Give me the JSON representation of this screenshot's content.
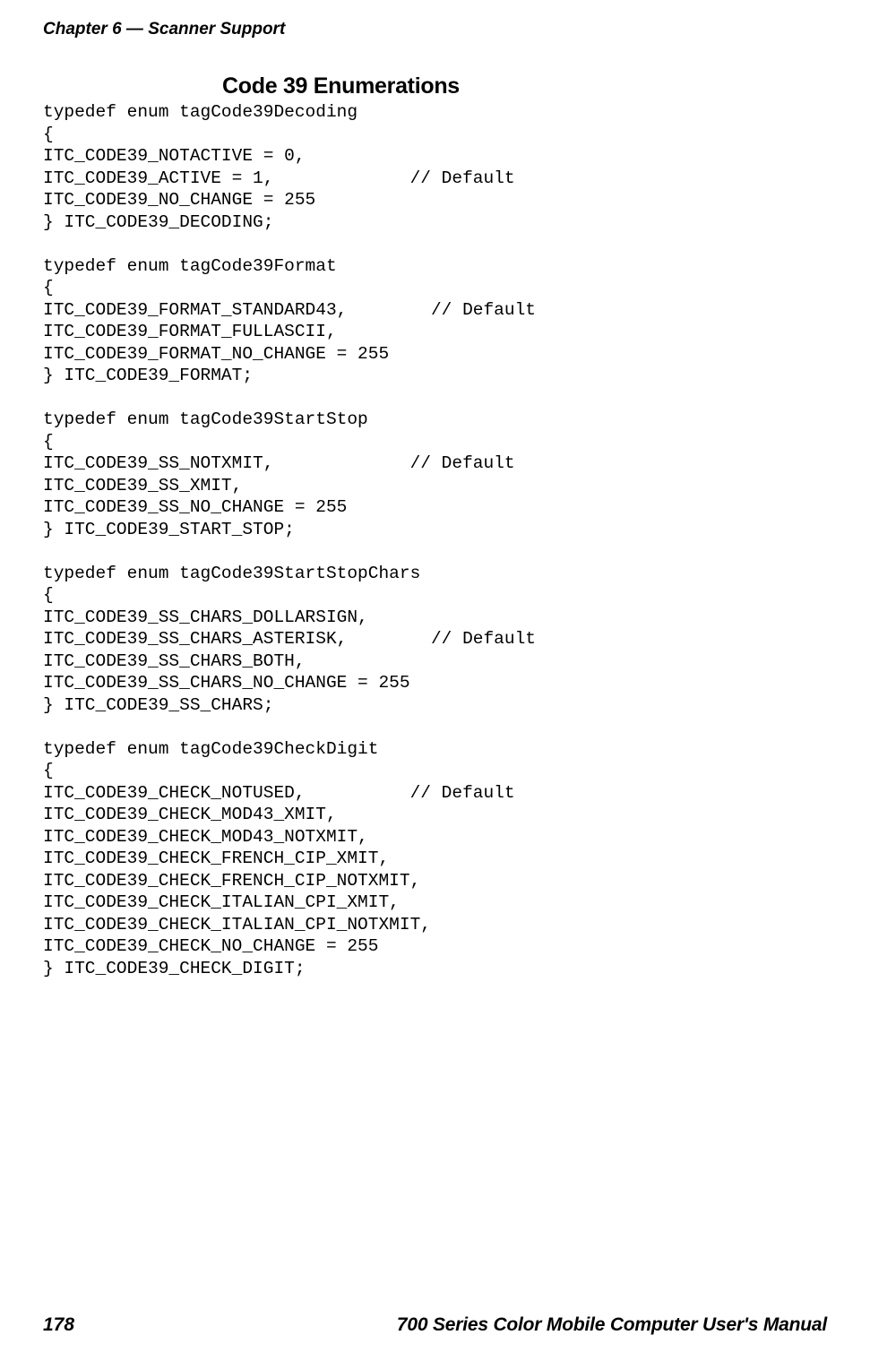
{
  "header": {
    "chapter_label": "Chapter 6",
    "separator": "  —  ",
    "section_label": "Scanner Support"
  },
  "title": "Code 39 Enumerations",
  "code": "typedef enum tagCode39Decoding\n{\nITC_CODE39_NOTACTIVE = 0,\nITC_CODE39_ACTIVE = 1,             // Default\nITC_CODE39_NO_CHANGE = 255\n} ITC_CODE39_DECODING;\n\ntypedef enum tagCode39Format\n{\nITC_CODE39_FORMAT_STANDARD43,        // Default\nITC_CODE39_FORMAT_FULLASCII,\nITC_CODE39_FORMAT_NO_CHANGE = 255\n} ITC_CODE39_FORMAT;\n\ntypedef enum tagCode39StartStop\n{\nITC_CODE39_SS_NOTXMIT,             // Default\nITC_CODE39_SS_XMIT,\nITC_CODE39_SS_NO_CHANGE = 255\n} ITC_CODE39_START_STOP;\n\ntypedef enum tagCode39StartStopChars\n{\nITC_CODE39_SS_CHARS_DOLLARSIGN,\nITC_CODE39_SS_CHARS_ASTERISK,        // Default\nITC_CODE39_SS_CHARS_BOTH,\nITC_CODE39_SS_CHARS_NO_CHANGE = 255\n} ITC_CODE39_SS_CHARS;\n\ntypedef enum tagCode39CheckDigit\n{\nITC_CODE39_CHECK_NOTUSED,          // Default\nITC_CODE39_CHECK_MOD43_XMIT,\nITC_CODE39_CHECK_MOD43_NOTXMIT,\nITC_CODE39_CHECK_FRENCH_CIP_XMIT,\nITC_CODE39_CHECK_FRENCH_CIP_NOTXMIT,\nITC_CODE39_CHECK_ITALIAN_CPI_XMIT,\nITC_CODE39_CHECK_ITALIAN_CPI_NOTXMIT,\nITC_CODE39_CHECK_NO_CHANGE = 255\n} ITC_CODE39_CHECK_DIGIT;",
  "footer": {
    "page_number": "178",
    "manual_title": "700 Series Color Mobile Computer User's Manual"
  }
}
